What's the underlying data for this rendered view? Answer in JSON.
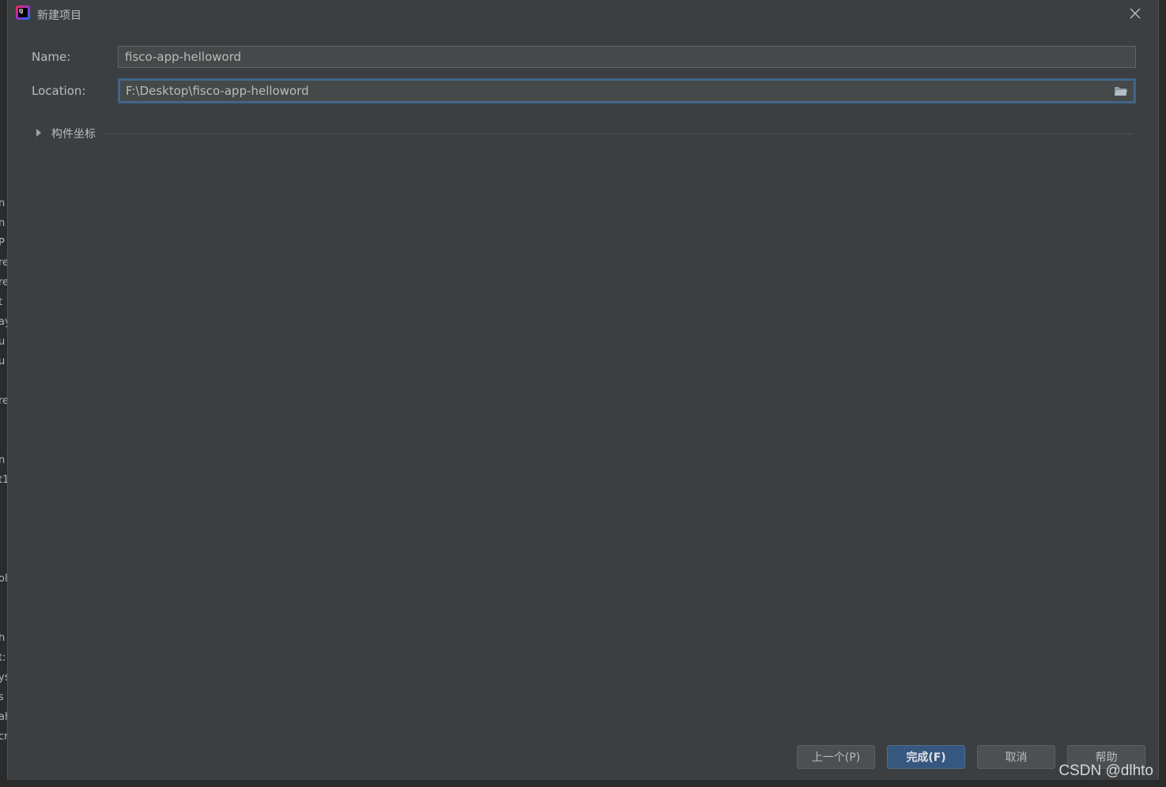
{
  "dialog": {
    "title": "新建项目"
  },
  "form": {
    "name_label": "Name:",
    "name_value": "fisco-app-helloword",
    "location_label": "Location:",
    "location_value": "F:\\Desktop\\fisco-app-helloword"
  },
  "section": {
    "label": "构件坐标",
    "expanded": false
  },
  "buttons": {
    "previous": "上一个(P)",
    "finish": "完成(F)",
    "cancel": "取消",
    "help": "帮助"
  },
  "watermark": "CSDN @dlhto",
  "background_fragments": [
    "n",
    "n",
    "P",
    "re",
    "re",
    "t",
    "ay",
    "u",
    "u",
    "re",
    "n",
    "t1",
    "ol",
    "h",
    "t:",
    "ys",
    "s",
    "ah",
    "cr"
  ],
  "colors": {
    "dialog_bg": "#3c3f41",
    "field_bg": "#45494a",
    "focus_border": "#3d6185",
    "primary_button": "#365880",
    "text": "#bbbbbb"
  }
}
